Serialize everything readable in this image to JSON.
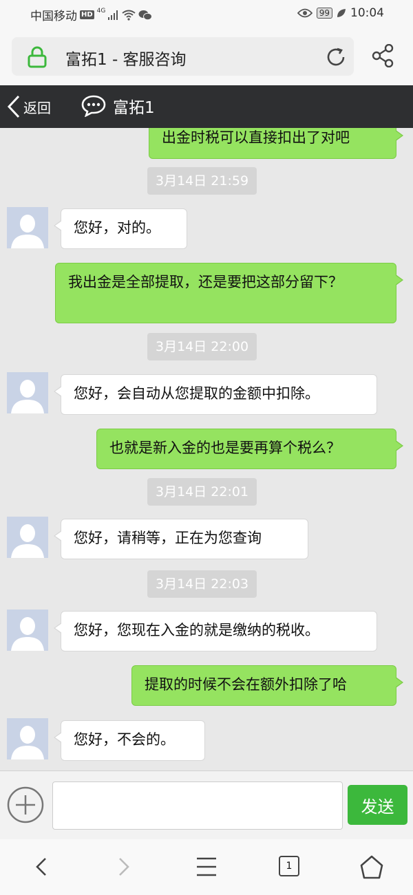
{
  "status_bar": {
    "carrier": "中国移动",
    "hd": "HD",
    "net": "4G",
    "battery": "99",
    "time": "10:04"
  },
  "url_bar": {
    "title": "富拓1 - 客服咨询"
  },
  "header": {
    "back_label": "返回",
    "title": "富拓1"
  },
  "messages": [
    {
      "type": "out",
      "text": "出金时税可以直接扣出了对吧"
    },
    {
      "type": "time",
      "text": "3月14日 21:59"
    },
    {
      "type": "in",
      "text": "您好，对的。"
    },
    {
      "type": "out",
      "text": "我出金是全部提取，还是要把这部分留下？"
    },
    {
      "type": "time",
      "text": "3月14日 22:00"
    },
    {
      "type": "in",
      "text": "您好，会自动从您提取的金额中扣除。"
    },
    {
      "type": "out",
      "text": "也就是新入金的也是要再算个税么？"
    },
    {
      "type": "time",
      "text": "3月14日 22:01"
    },
    {
      "type": "in",
      "text": "您好，请稍等，正在为您查询"
    },
    {
      "type": "time",
      "text": "3月14日 22:03"
    },
    {
      "type": "in",
      "text": "您好，您现在入金的就是缴纳的税收。"
    },
    {
      "type": "out",
      "text": "提取的时候不会在额外扣除了哈"
    },
    {
      "type": "in",
      "text": "您好，不会的。"
    }
  ],
  "input_bar": {
    "value": "",
    "send_label": "发送"
  },
  "nav_bar": {
    "tab_count": "1"
  },
  "colors": {
    "outgoing_bubble": "#95e360",
    "incoming_bubble": "#ffffff",
    "header_bg": "#2e2f31",
    "send_button": "#3cb83c",
    "lock_icon": "#3cb83c"
  }
}
